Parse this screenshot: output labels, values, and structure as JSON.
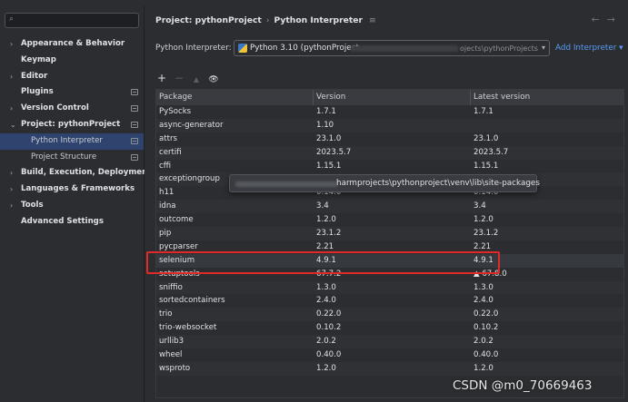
{
  "sidebar": {
    "items": [
      {
        "label": "Appearance & Behavior",
        "arrow": "›",
        "level": 0,
        "badge": false,
        "selected": false
      },
      {
        "label": "Keymap",
        "arrow": "",
        "level": 0,
        "badge": false,
        "selected": false
      },
      {
        "label": "Editor",
        "arrow": "›",
        "level": 0,
        "badge": false,
        "selected": false
      },
      {
        "label": "Plugins",
        "arrow": "",
        "level": 0,
        "badge": true,
        "selected": false
      },
      {
        "label": "Version Control",
        "arrow": "›",
        "level": 0,
        "badge": true,
        "selected": false
      },
      {
        "label": "Project: pythonProject",
        "arrow": "⌄",
        "level": 0,
        "badge": true,
        "selected": false
      },
      {
        "label": "Python Interpreter",
        "arrow": "",
        "level": 1,
        "badge": true,
        "selected": true
      },
      {
        "label": "Project Structure",
        "arrow": "",
        "level": 1,
        "badge": true,
        "selected": false
      },
      {
        "label": "Build, Execution, Deployment",
        "arrow": "›",
        "level": 0,
        "badge": false,
        "selected": false
      },
      {
        "label": "Languages & Frameworks",
        "arrow": "›",
        "level": 0,
        "badge": false,
        "selected": false
      },
      {
        "label": "Tools",
        "arrow": "›",
        "level": 0,
        "badge": false,
        "selected": false
      },
      {
        "label": "Advanced Settings",
        "arrow": "",
        "level": 0,
        "badge": false,
        "selected": false
      }
    ]
  },
  "header": {
    "crumb_project": "Project: pythonProject",
    "crumb_sep": "›",
    "crumb_page": "Python Interpreter",
    "menu_glyph": "≡",
    "nav_arrows": "←→"
  },
  "interpreter": {
    "label": "Python Interpreter:",
    "value": "Python 3.10 (pythonProject",
    "path_tail": "ojects\\pythonProjects",
    "dropdown_glyph": "▾",
    "add_link": "Add Interpreter ▾"
  },
  "toolbar": {
    "add": "+",
    "remove": "−",
    "upgrade": "▲",
    "show": "👁"
  },
  "table": {
    "columns": [
      "Package",
      "Version",
      "Latest version"
    ],
    "rows": [
      {
        "package": "PySocks",
        "version": "1.7.1",
        "latest": "1.7.1"
      },
      {
        "package": "async-generator",
        "version": "1.10",
        "latest": ""
      },
      {
        "package": "attrs",
        "version": "23.1.0",
        "latest": "23.1.0"
      },
      {
        "package": "certifi",
        "version": "2023.5.7",
        "latest": "2023.5.7"
      },
      {
        "package": "cffi",
        "version": "1.15.1",
        "latest": "1.15.1"
      },
      {
        "package": "exceptiongroup",
        "version": "",
        "latest": ""
      },
      {
        "package": "h11",
        "version": "0.14.0",
        "latest": "0.14.0"
      },
      {
        "package": "idna",
        "version": "3.4",
        "latest": "3.4"
      },
      {
        "package": "outcome",
        "version": "1.2.0",
        "latest": "1.2.0"
      },
      {
        "package": "pip",
        "version": "23.1.2",
        "latest": "23.1.2"
      },
      {
        "package": "pycparser",
        "version": "2.21",
        "latest": "2.21"
      },
      {
        "package": "selenium",
        "version": "4.9.1",
        "latest": "4.9.1"
      },
      {
        "package": "setuptools",
        "version": "67.7.2",
        "latest": "▲ 67.8.0"
      },
      {
        "package": "sniffio",
        "version": "1.3.0",
        "latest": "1.3.0"
      },
      {
        "package": "sortedcontainers",
        "version": "2.4.0",
        "latest": "2.4.0"
      },
      {
        "package": "trio",
        "version": "0.22.0",
        "latest": "0.22.0"
      },
      {
        "package": "trio-websocket",
        "version": "0.10.2",
        "latest": "0.10.2"
      },
      {
        "package": "urllib3",
        "version": "2.0.2",
        "latest": "2.0.2"
      },
      {
        "package": "wheel",
        "version": "0.40.0",
        "latest": "0.40.0"
      },
      {
        "package": "wsproto",
        "version": "1.2.0",
        "latest": "1.2.0"
      }
    ]
  },
  "tooltip": {
    "text": "harmprojects\\pythonproject\\venv\\lib\\site-packages"
  },
  "watermark": "CSDN @m0_70669463"
}
